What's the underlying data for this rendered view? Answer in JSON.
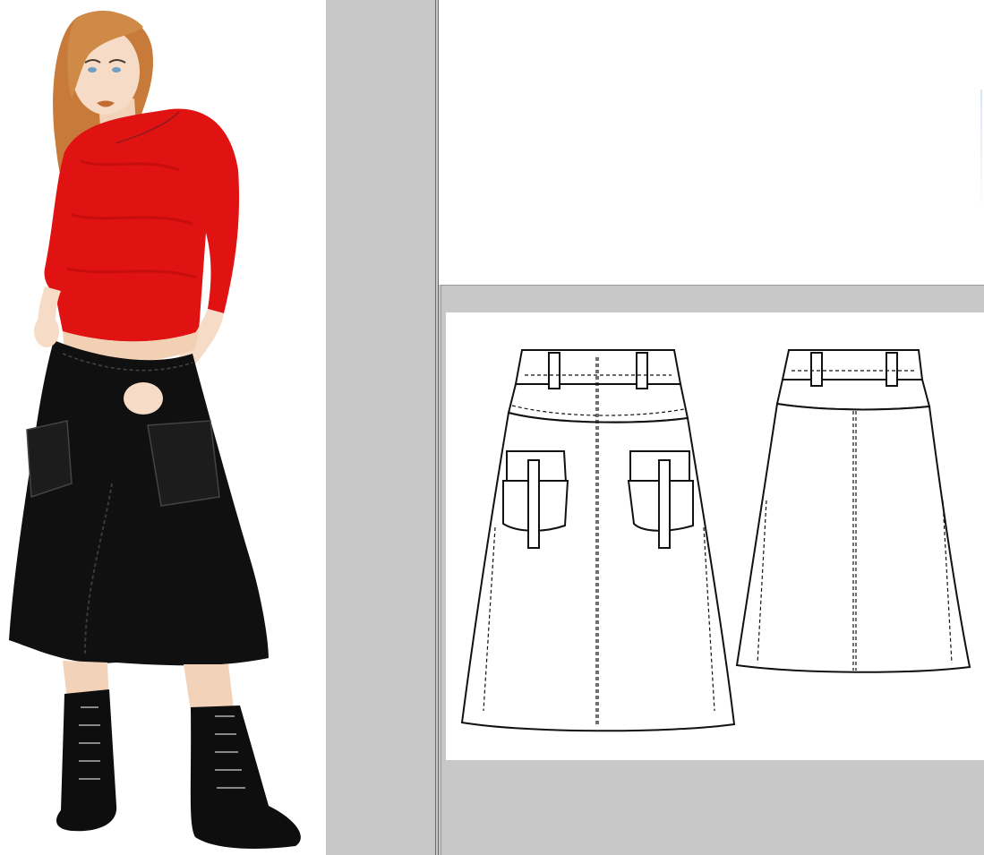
{
  "header": {
    "title": ""
  },
  "figure": {
    "subject": "fashion-illustration"
  },
  "colors": {
    "top": "#e01212",
    "skirt": "#101010",
    "hair": "#c87a3a",
    "skin": "#f6dcc6",
    "frame_gray": "#c8c8c8"
  },
  "sketches": [
    "front-view",
    "back-view"
  ]
}
